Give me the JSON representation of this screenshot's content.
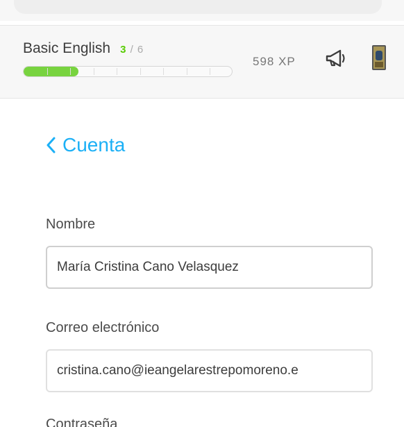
{
  "course": {
    "title": "Basic English",
    "progress_current": "3",
    "progress_separator": "/",
    "progress_total": "6",
    "progress_fraction": 0.26,
    "segments": 9,
    "xp": "598 XP"
  },
  "account": {
    "back_label": "Cuenta",
    "name_label": "Nombre",
    "name_value": "María Cristina Cano Velasquez",
    "email_label": "Correo electrónico",
    "email_value": "cristina.cano@ieangelarestrepomoreno.e",
    "password_label": "Contraseña"
  },
  "colors": {
    "accent": "#1cb0f6",
    "progress_green": "#58cc02"
  }
}
